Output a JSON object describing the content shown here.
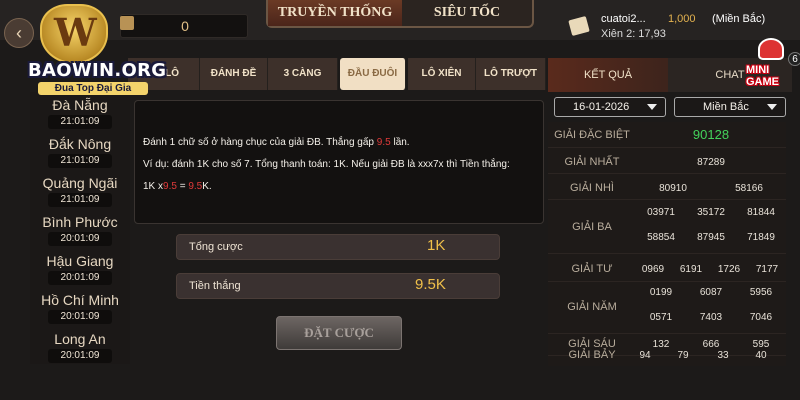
{
  "header": {
    "back_icon": "chevron-left-icon",
    "logo": {
      "name": "BAOWIN.ORG",
      "slogan": "Đua Top Đại Gia"
    },
    "balance": "0",
    "mode_tabs": [
      "TRUYỀN THỐNG",
      "SIÊU TỐC"
    ],
    "active_mode": 0,
    "recent_bet": {
      "user": "cuatoi2...",
      "amount": "1,000",
      "region": "(Miền Bắc)",
      "detail": "Xiên 2: 17,93"
    },
    "mini_game": {
      "label": "MINI GAME",
      "badge": "6"
    }
  },
  "provinces": [
    {
      "name": "Đà Nẵng",
      "time": "21:01:09"
    },
    {
      "name": "Đắk Nông",
      "time": "21:01:09"
    },
    {
      "name": "Quảng Ngãi",
      "time": "21:01:09"
    },
    {
      "name": "Bình Phước",
      "time": "20:01:09"
    },
    {
      "name": "Hậu Giang",
      "time": "20:01:09"
    },
    {
      "name": "Hồ Chí Minh",
      "time": "20:01:09"
    },
    {
      "name": "Long An",
      "time": "20:01:09"
    }
  ],
  "game_tabs": [
    "NH LÔ",
    "ĐÁNH ĐỀ",
    "3 CÀNG",
    "ĐẦU ĐUÔI",
    "LÔ XIÊN",
    "LÔ TRƯỢT"
  ],
  "active_game_tab": 3,
  "description": {
    "line1_prefix": "Đánh 1 chữ số ở hàng chục của giải ĐB. Thắng gấp ",
    "line1_highlight": "9.5",
    "line1_suffix": " lần.",
    "line2": "Ví dụ: đánh 1K cho số 7. Tổng thanh toán: 1K. Nếu giải ĐB là xxx7x thì Tiền thắng:",
    "line3_a": "1K x",
    "line3_b": "9.5",
    "line3_c": " = ",
    "line3_d": "9.5",
    "line3_e": "K."
  },
  "summary": {
    "total_label": "Tổng cược",
    "total_value": "1K",
    "win_label": "Tiền thắng",
    "win_value": "9.5K"
  },
  "bet_button": "ĐẶT CƯỢC",
  "results": {
    "tab_results": "KẾT QUẢ",
    "tab_chat": "CHAT",
    "active_tab": 0,
    "date": "16-01-2026",
    "region": "Miền Bắc",
    "rows": [
      {
        "label": "GIẢI ĐẶC BIỆT",
        "numbers": [
          "90128"
        ]
      },
      {
        "label": "GIẢI NHẤT",
        "numbers": [
          "87289"
        ]
      },
      {
        "label": "GIẢI NHÌ",
        "numbers": [
          "80910",
          "58166"
        ]
      },
      {
        "label": "GIẢI BA",
        "numbers": [
          "03971",
          "35172",
          "81844",
          "58854",
          "87945",
          "71849"
        ]
      },
      {
        "label": "GIẢI TƯ",
        "numbers": [
          "0969",
          "6191",
          "1726",
          "7177"
        ]
      },
      {
        "label": "GIẢI NĂM",
        "numbers": [
          "0199",
          "6087",
          "5956",
          "0571",
          "7403",
          "7046"
        ]
      },
      {
        "label": "GIẢI SÁU",
        "numbers": [
          "132",
          "666",
          "595"
        ]
      },
      {
        "label": "GIẢI BẢY",
        "numbers": [
          "94",
          "79",
          "33",
          "40"
        ]
      }
    ]
  }
}
